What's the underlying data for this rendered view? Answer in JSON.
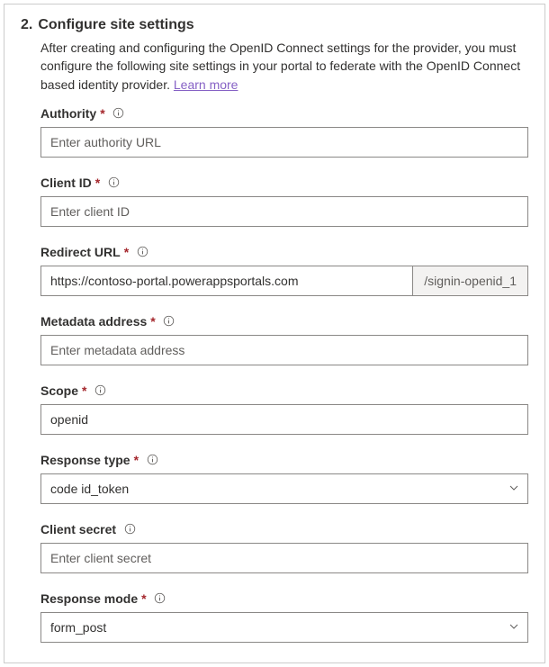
{
  "step": {
    "number": "2.",
    "title": "Configure site settings",
    "description": "After creating and configuring the OpenID Connect settings for the provider, you must configure the following site settings in your portal to federate with the OpenID Connect based identity provider. ",
    "learn_more": "Learn more"
  },
  "fields": {
    "authority": {
      "label": "Authority",
      "required": "*",
      "placeholder": "Enter authority URL",
      "value": ""
    },
    "client_id": {
      "label": "Client ID",
      "required": "*",
      "placeholder": "Enter client ID",
      "value": ""
    },
    "redirect_url": {
      "label": "Redirect URL",
      "required": "*",
      "value": "https://contoso-portal.powerappsportals.com",
      "suffix": "/signin-openid_1"
    },
    "metadata_address": {
      "label": "Metadata address",
      "required": "*",
      "placeholder": "Enter metadata address",
      "value": ""
    },
    "scope": {
      "label": "Scope",
      "required": "*",
      "value": "openid"
    },
    "response_type": {
      "label": "Response type",
      "required": "*",
      "value": "code id_token"
    },
    "client_secret": {
      "label": "Client secret",
      "placeholder": "Enter client secret",
      "value": ""
    },
    "response_mode": {
      "label": "Response mode",
      "required": "*",
      "value": "form_post"
    }
  }
}
